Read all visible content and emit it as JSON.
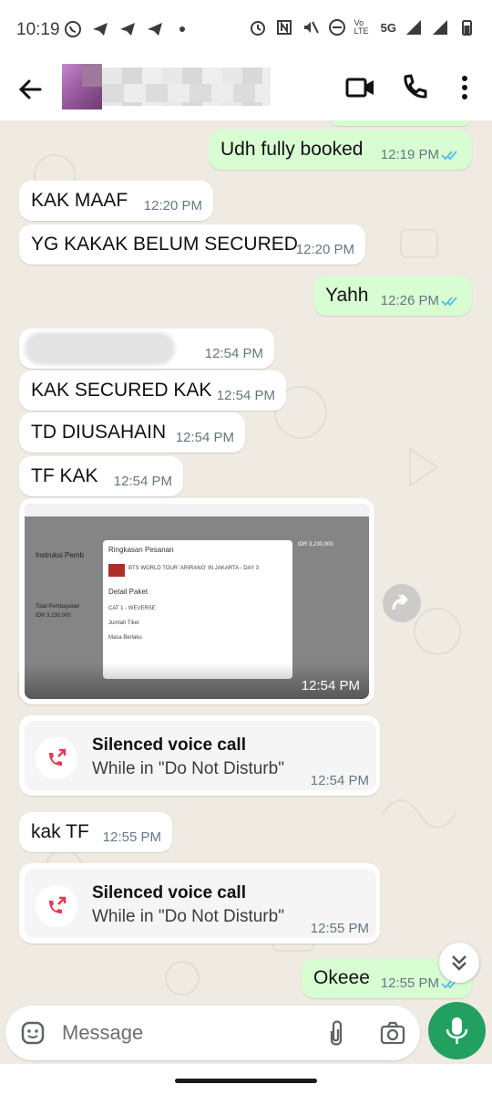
{
  "status_bar": {
    "time": "10:19",
    "left_icons": [
      "whatsapp-icon",
      "telegram-icon",
      "telegram-icon",
      "telegram-icon",
      "dot-icon"
    ],
    "right_icons": [
      "alarm-icon",
      "nfc-icon",
      "mute-icon",
      "dnd-icon",
      "volte-icon",
      "5g-signal-icon",
      "signal-icon",
      "battery-icon"
    ],
    "network_label": "5G",
    "volte_label": "Vo LTE"
  },
  "header": {
    "back_icon": "back-arrow-icon",
    "actions": [
      "video-call-icon",
      "voice-call-icon",
      "more-vert-icon"
    ]
  },
  "messages": [
    {
      "dir": "out",
      "text": "Udh fully booked",
      "time": "12:19 PM",
      "read": true
    },
    {
      "dir": "in",
      "text": "KAK MAAF",
      "time": "12:20 PM"
    },
    {
      "dir": "in",
      "text": "YG KAKAK BELUM SECURED",
      "time": "12:20 PM"
    },
    {
      "dir": "out",
      "text": "Yahh",
      "time": "12:26 PM",
      "read": true
    },
    {
      "dir": "in",
      "text": "",
      "time": "12:54 PM"
    },
    {
      "dir": "in",
      "text": "KAK SECURED KAK",
      "time": "12:54 PM"
    },
    {
      "dir": "in",
      "text": "TD DIUSAHAIN",
      "time": "12:54 PM"
    },
    {
      "dir": "in",
      "text": "TF KAK",
      "time": "12:54 PM"
    },
    {
      "dir": "in",
      "type": "image",
      "time": "12:54 PM",
      "image": {
        "modal_title": "Ringkasan Pesanan",
        "item": "BTS WORLD TOUR 'ARIRANG' IN JAKARTA - DAY 3",
        "section": "Detail Paket",
        "category": "CAT 1 - WEVERSE",
        "qty_label": "Jumlah Tiket",
        "validity_label": "Masa Berlaku",
        "side_label": "Instruksi Pemb",
        "total_label": "Total Pembayaran",
        "total_value": "IDR 3,230,000"
      }
    },
    {
      "dir": "in",
      "type": "call",
      "title": "Silenced voice call",
      "subtitle": "While in \"Do Not Disturb\"",
      "time": "12:54 PM"
    },
    {
      "dir": "in",
      "text": "kak TF",
      "time": "12:55 PM"
    },
    {
      "dir": "in",
      "type": "call",
      "title": "Silenced voice call",
      "subtitle": "While in \"Do Not Disturb\"",
      "time": "12:55 PM"
    },
    {
      "dir": "out",
      "text": "Okeee",
      "time": "12:55 PM",
      "read": true
    }
  ],
  "composer": {
    "placeholder": "Message",
    "emoji_icon": "emoji-icon",
    "attach_icon": "paperclip-icon",
    "camera_icon": "camera-icon",
    "mic_icon": "mic-icon"
  },
  "colors": {
    "chat_bg": "#efeae2",
    "incoming": "#ffffff",
    "outgoing": "#d9fdd3",
    "read_ticks": "#53bdeb",
    "mic_button": "#21a060",
    "missed_call": "#e53950"
  }
}
